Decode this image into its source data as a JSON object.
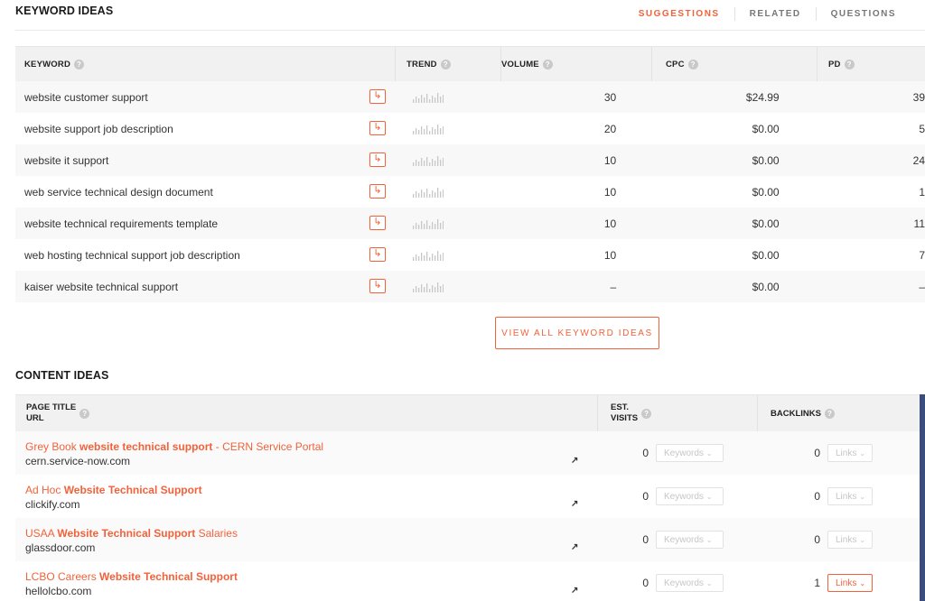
{
  "keyword_section": {
    "title": "KEYWORD IDEAS",
    "tabs": [
      {
        "label": "SUGGESTIONS",
        "active": true
      },
      {
        "label": "RELATED",
        "active": false
      },
      {
        "label": "QUESTIONS",
        "active": false
      }
    ],
    "columns": {
      "keyword": "KEYWORD",
      "trend": "TREND",
      "volume": "VOLUME",
      "cpc": "CPC",
      "pd": "PD"
    },
    "rows": [
      {
        "keyword": "website customer support",
        "volume": "30",
        "cpc": "$24.99",
        "pd": "39"
      },
      {
        "keyword": "website support job description",
        "volume": "20",
        "cpc": "$0.00",
        "pd": "5"
      },
      {
        "keyword": "website it support",
        "volume": "10",
        "cpc": "$0.00",
        "pd": "24"
      },
      {
        "keyword": "web service technical design document",
        "volume": "10",
        "cpc": "$0.00",
        "pd": "1"
      },
      {
        "keyword": "website technical requirements template",
        "volume": "10",
        "cpc": "$0.00",
        "pd": "11"
      },
      {
        "keyword": "web hosting technical support job description",
        "volume": "10",
        "cpc": "$0.00",
        "pd": "7"
      },
      {
        "keyword": "kaiser website technical support",
        "volume": "–",
        "cpc": "$0.00",
        "pd": "–"
      }
    ],
    "view_all_label": "VIEW ALL KEYWORD IDEAS"
  },
  "content_section": {
    "title": "CONTENT IDEAS",
    "columns": {
      "title_line1": "PAGE TITLE",
      "title_line2": "URL",
      "visits_line1": "EST.",
      "visits_line2": "VISITS",
      "backlinks": "BACKLINKS"
    },
    "rows": [
      {
        "title_pre": "Grey Book ",
        "title_bold": "website technical support",
        "title_post": " - CERN Service Portal",
        "url": "cern.service-now.com",
        "visits": "0",
        "keywords_label": "Keywords",
        "backlinks": "0",
        "links_label": "Links",
        "links_active": false
      },
      {
        "title_pre": "Ad Hoc ",
        "title_bold": "Website Technical Support",
        "title_post": "",
        "url": "clickify.com",
        "visits": "0",
        "keywords_label": "Keywords",
        "backlinks": "0",
        "links_label": "Links",
        "links_active": false
      },
      {
        "title_pre": "USAA ",
        "title_bold": "Website Technical Support",
        "title_post": " Salaries",
        "url": "glassdoor.com",
        "visits": "0",
        "keywords_label": "Keywords",
        "backlinks": "0",
        "links_label": "Links",
        "links_active": false
      },
      {
        "title_pre": "LCBO Careers ",
        "title_bold": "Website Technical Support",
        "title_post": "",
        "url": "hellolcbo.com",
        "visits": "0",
        "keywords_label": "Keywords",
        "backlinks": "1",
        "links_label": "Links",
        "links_active": true
      }
    ]
  },
  "colors": {
    "accent": "#f2623a",
    "header_bg": "#f1f1f1",
    "scroll_bar": "#3b4d7c"
  },
  "icons": {
    "help": "question-circle-icon",
    "keyword_action": "arrow-turn-right-icon",
    "trend": "bar-sparkline-icon",
    "external": "external-link-icon",
    "dropdown": "chevron-down-icon"
  }
}
